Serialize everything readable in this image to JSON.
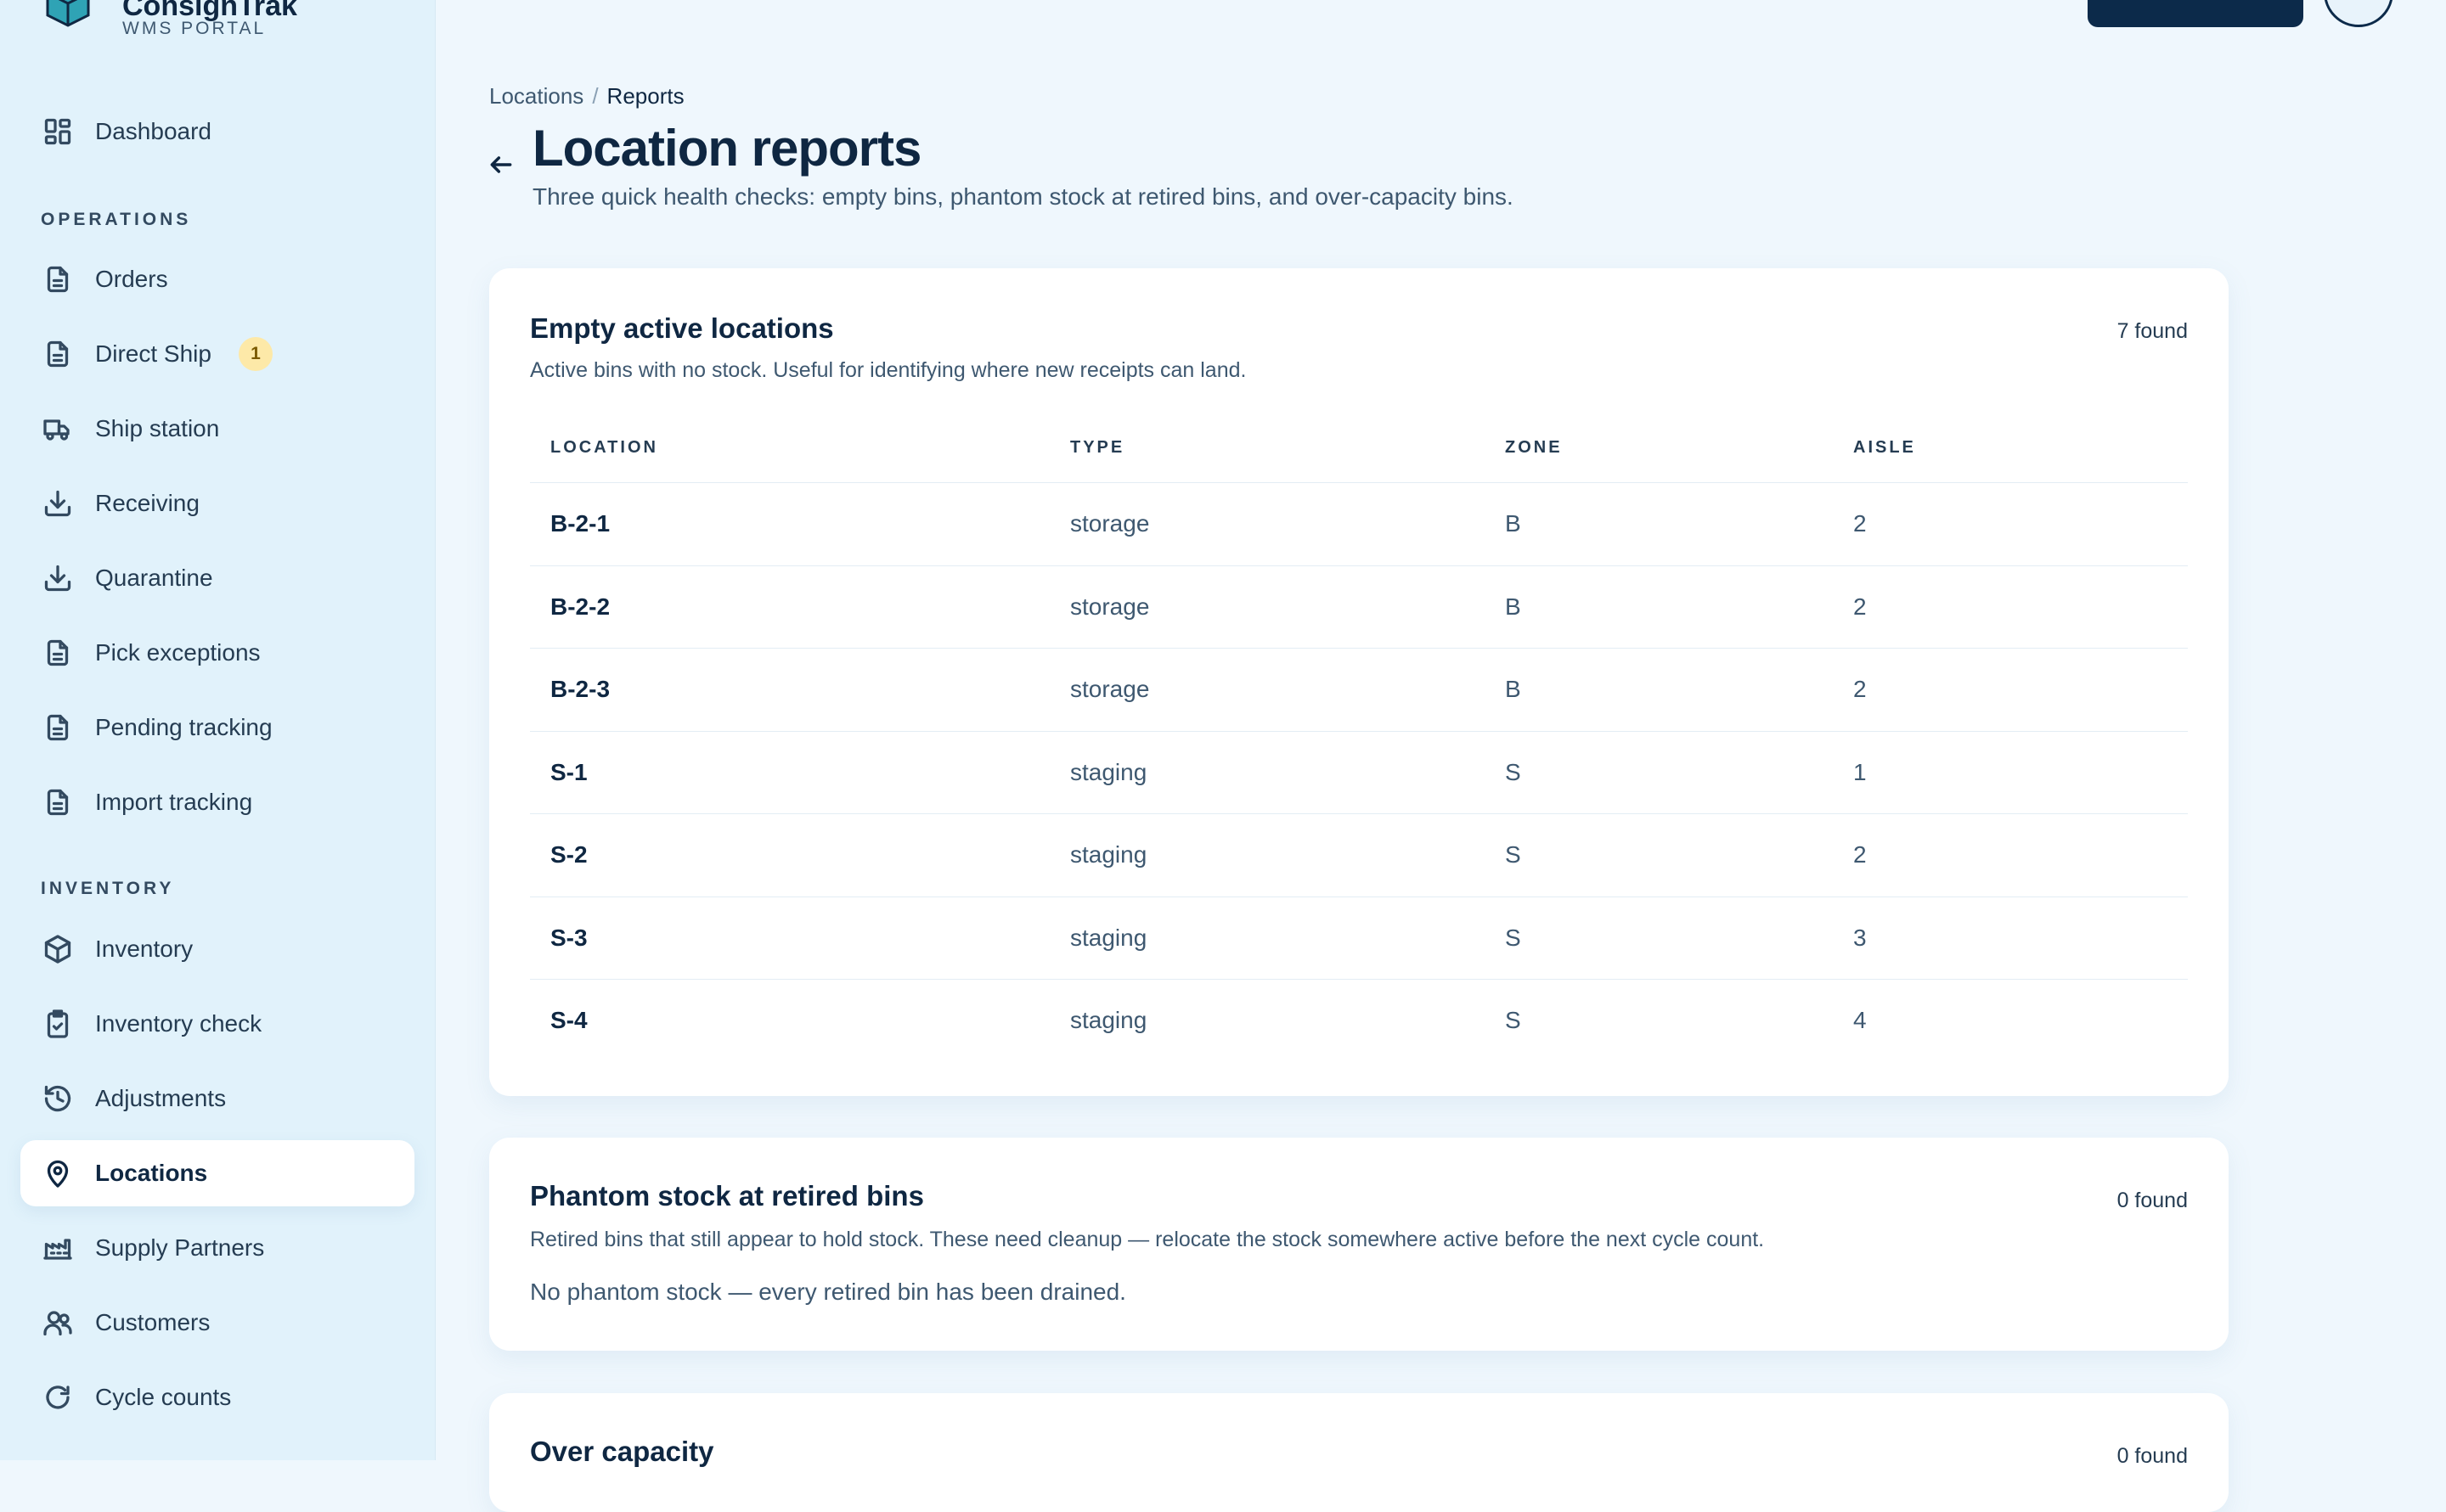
{
  "brand": {
    "name": "ConsignTrak",
    "subtitle": "WMS PORTAL"
  },
  "sidebar": {
    "dashboard": {
      "label": "Dashboard",
      "icon": "dashboard-icon"
    },
    "sections": {
      "operations": "OPERATIONS",
      "inventory": "INVENTORY"
    },
    "items": [
      {
        "label": "Orders",
        "icon": "document-icon"
      },
      {
        "label": "Direct Ship",
        "icon": "document-icon",
        "badge": "1"
      },
      {
        "label": "Ship station",
        "icon": "truck-icon"
      },
      {
        "label": "Receiving",
        "icon": "download-icon"
      },
      {
        "label": "Quarantine",
        "icon": "download-icon"
      },
      {
        "label": "Pick exceptions",
        "icon": "document-icon"
      },
      {
        "label": "Pending tracking",
        "icon": "document-icon"
      },
      {
        "label": "Import tracking",
        "icon": "document-icon"
      },
      {
        "label": "Inventory",
        "icon": "box-icon"
      },
      {
        "label": "Inventory check",
        "icon": "clipboard-check-icon"
      },
      {
        "label": "Adjustments",
        "icon": "history-icon"
      },
      {
        "label": "Locations",
        "icon": "map-pin-icon",
        "active": true
      },
      {
        "label": "Supply Partners",
        "icon": "factory-icon"
      },
      {
        "label": "Customers",
        "icon": "users-icon"
      },
      {
        "label": "Cycle counts",
        "icon": "refresh-icon"
      }
    ]
  },
  "breadcrumb": {
    "parent": "Locations",
    "separator": "/",
    "current": "Reports"
  },
  "page": {
    "title": "Location reports",
    "subtitle": "Three quick health checks: empty bins, phantom stock at retired bins, and over-capacity bins."
  },
  "empty_locations": {
    "title": "Empty active locations",
    "count": "7 found",
    "description": "Active bins with no stock. Useful for identifying where new receipts can land.",
    "columns": [
      "LOCATION",
      "TYPE",
      "ZONE",
      "AISLE"
    ],
    "rows": [
      [
        "B-2-1",
        "storage",
        "B",
        "2"
      ],
      [
        "B-2-2",
        "storage",
        "B",
        "2"
      ],
      [
        "B-2-3",
        "storage",
        "B",
        "2"
      ],
      [
        "S-1",
        "staging",
        "S",
        "1"
      ],
      [
        "S-2",
        "staging",
        "S",
        "2"
      ],
      [
        "S-3",
        "staging",
        "S",
        "3"
      ],
      [
        "S-4",
        "staging",
        "S",
        "4"
      ]
    ]
  },
  "phantom_stock": {
    "title": "Phantom stock at retired bins",
    "count": "0 found",
    "description": "Retired bins that still appear to hold stock. These need cleanup — relocate the stock somewhere active before the next cycle count.",
    "empty_message": "No phantom stock — every retired bin has been drained."
  },
  "over_capacity": {
    "title": "Over capacity",
    "count": "0 found"
  },
  "colors": {
    "accent": "#0c2a4a",
    "badge_bg": "#fde9a8",
    "sidebar_bg": "#e1f2fb",
    "page_bg": "#eff7fd"
  }
}
